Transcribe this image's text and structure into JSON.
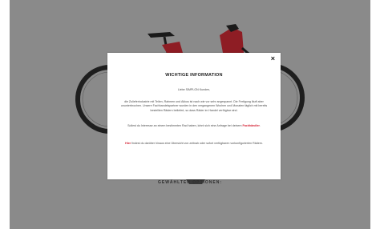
{
  "modal": {
    "close_symbol": "×",
    "title": "WICHTIGE INFORMATION",
    "greeting": "Liebe SIMPLON Kunden,",
    "paragraph1": "die Zulieferindustrie mit Teilen, Rahmen und Akkus ist nach wie vor sehr angespannt. Die Fertigung läuft aber ununterbrochen. Unsere Fachhandelspartner wurden in den vergangenen Wochen und Monaten täglich mit bereits bestellten Rädern beliefert, so dass Räder im Handel verfügbar sind.",
    "paragraph2_before": "Sollest du Interesse an einem bestimmten Rad haben, lohnt sich eine Anfrage bei deinem",
    "paragraph2_link": "Fachhändler",
    "paragraph2_after": ".",
    "paragraph3_link": "Hier",
    "paragraph3_after": "findest du darüber hinaus eine Übersicht von zeitnah oder sofort verfügbaren vorkonfigurierten Rädern."
  },
  "background": {
    "bottom_label": "GEWÄHLTEN OPTIONEN:"
  },
  "colors": {
    "overlay_gray": "#8a8a8a",
    "frame_red": "#8e1d24",
    "link_red": "#d2182b"
  },
  "icons": [
    "close-icon",
    "bicycle-image"
  ]
}
